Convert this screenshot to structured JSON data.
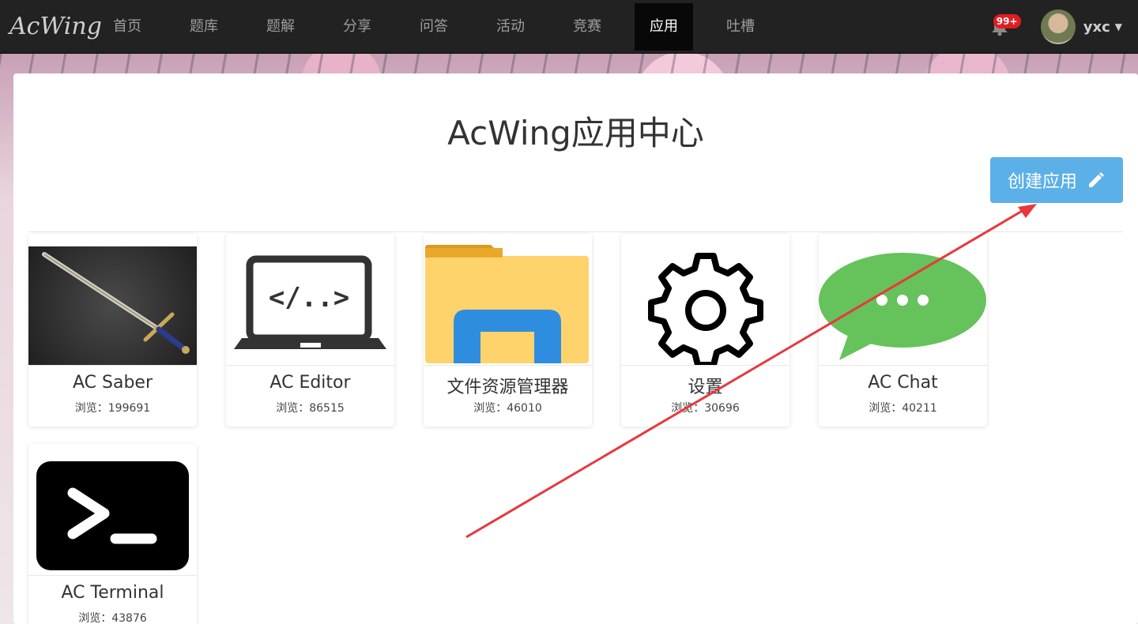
{
  "navbar": {
    "brand": "AcWing",
    "items": [
      {
        "label": "首页",
        "active": false
      },
      {
        "label": "题库",
        "active": false
      },
      {
        "label": "题解",
        "active": false
      },
      {
        "label": "分享",
        "active": false
      },
      {
        "label": "问答",
        "active": false
      },
      {
        "label": "活动",
        "active": false
      },
      {
        "label": "竞赛",
        "active": false
      },
      {
        "label": "应用",
        "active": true
      },
      {
        "label": "吐槽",
        "active": false
      }
    ],
    "notification_badge": "99+",
    "username": "yxc"
  },
  "page": {
    "title": "AcWing应用中心",
    "create_button": "创建应用"
  },
  "apps": [
    {
      "name": "AC Saber",
      "views_label": "浏览：199691",
      "icon": "sword-icon"
    },
    {
      "name": "AC Editor",
      "views_label": "浏览：86515",
      "icon": "laptop-code-icon"
    },
    {
      "name": "文件资源管理器",
      "views_label": "浏览：46010",
      "icon": "folder-icon"
    },
    {
      "name": "设置",
      "views_label": "浏览：30696",
      "icon": "gear-icon"
    },
    {
      "name": "AC Chat",
      "views_label": "浏览：40211",
      "icon": "chat-bubble-icon"
    },
    {
      "name": "AC Terminal",
      "views_label": "浏览：43876",
      "icon": "terminal-icon"
    }
  ],
  "colors": {
    "navbar_bg": "#222222",
    "active_nav_bg": "#080808",
    "create_button_bg": "#5bb0e8",
    "badge": "#e31b23",
    "annotation_arrow": "#e8383d"
  }
}
